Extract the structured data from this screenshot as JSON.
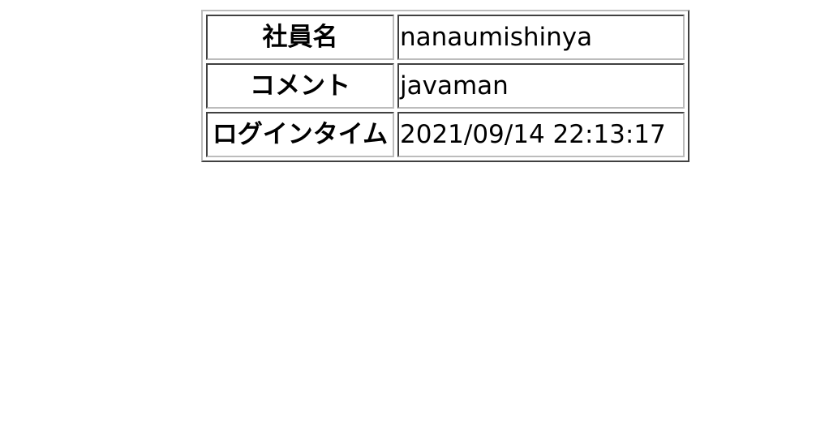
{
  "profile_table": {
    "rows": [
      {
        "label": "社員名",
        "value": "nanaumishinya"
      },
      {
        "label": "コメント",
        "value": "javaman"
      },
      {
        "label": "ログインタイム",
        "value": "2021/09/14 22:13:17"
      }
    ]
  }
}
